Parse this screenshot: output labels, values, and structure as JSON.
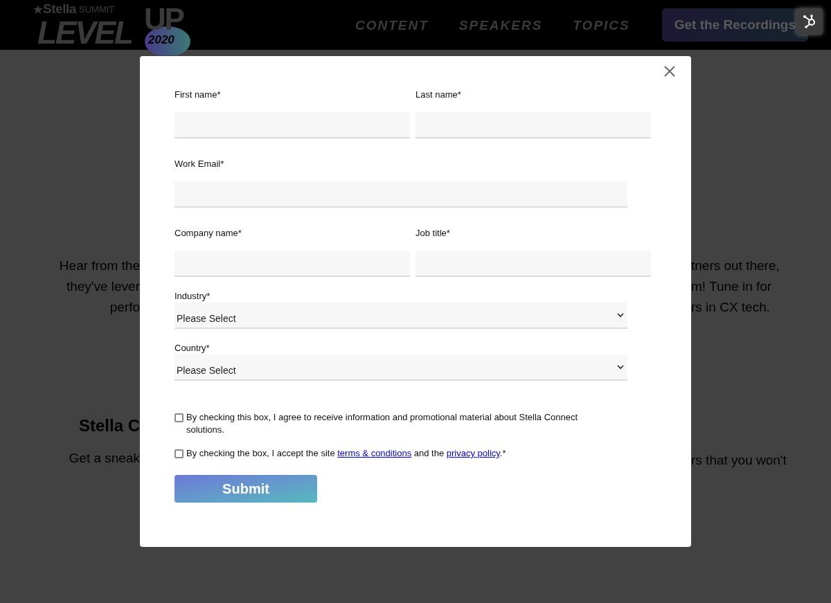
{
  "logo": {
    "brand": "Stella",
    "sub": "SUMMIT",
    "title": "LEVEL",
    "title2": "UP",
    "year": "2020"
  },
  "nav": [
    "CONTENT",
    "SPEAKERS",
    "TOPICS"
  ],
  "header_button": "Get the Recordings",
  "background_text": {
    "left": [
      "Hear from the",
      "they've lever",
      "perfo"
    ],
    "right": [
      "tners out there,",
      "m! Tune in for",
      "rs in CX tech."
    ],
    "heading_left": "Stella C",
    "bottom_left": "Get a sneak",
    "bottom_right": "rs that you won't"
  },
  "form": {
    "rows": [
      [
        {
          "label": "First name*",
          "kind": "text"
        },
        {
          "label": "Last name*",
          "kind": "text"
        }
      ],
      [
        {
          "label": "Work Email*",
          "kind": "text"
        }
      ],
      [
        {
          "label": "Company name*",
          "kind": "text"
        },
        {
          "label": "Job title*",
          "kind": "text"
        }
      ],
      [
        {
          "label": "Industry*",
          "kind": "select",
          "value": "Please Select"
        }
      ],
      [
        {
          "label": "Country*",
          "kind": "select",
          "value": "Please Select"
        }
      ]
    ],
    "consents": [
      {
        "checked": false,
        "parts": [
          {
            "kind": "text",
            "text": "By checking this box, I agree to receive information and promotional material about Stella Connect solutions."
          }
        ]
      },
      {
        "checked": false,
        "parts": [
          {
            "kind": "text",
            "text": "By checking the box, I accept the site "
          },
          {
            "kind": "link",
            "text": "terms & conditions"
          },
          {
            "kind": "text",
            "text": " and the "
          },
          {
            "kind": "link",
            "text": "privacy policy"
          },
          {
            "kind": "text",
            "text": ".*"
          }
        ]
      }
    ],
    "submit": "Submit"
  }
}
